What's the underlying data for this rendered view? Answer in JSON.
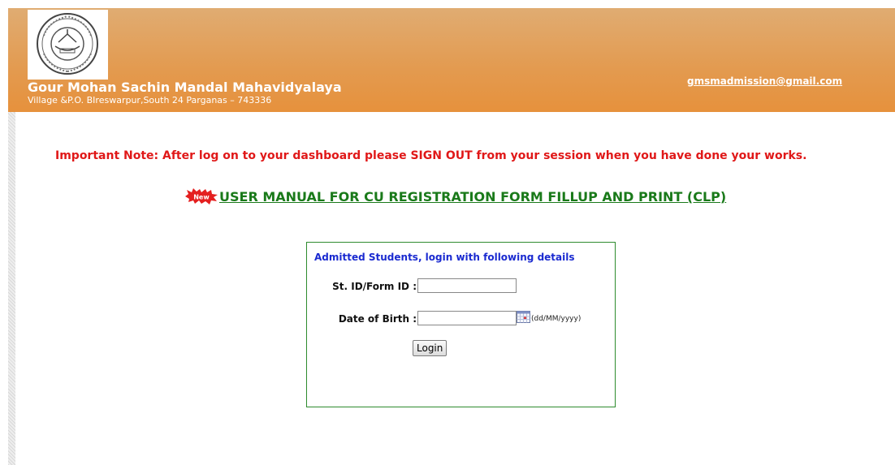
{
  "header": {
    "college_name": "Gour Mohan Sachin Mandal Mahavidyalaya",
    "address": "Village &P.O. BIreswarpur,South 24 Parganas – 743336",
    "email": "gmsmadmission@gmail.com",
    "background_color": "#e6913c"
  },
  "notice": {
    "text": "Important Note: After log on to your dashboard please SIGN OUT from your session when you have done your works.",
    "color": "#e01818"
  },
  "manual": {
    "badge": "New",
    "link_text": "USER MANUAL FOR CU REGISTRATION FORM FILLUP AND PRINT (CLP)",
    "color": "#1a7a1a"
  },
  "login": {
    "title": "Admitted Students, login with following details",
    "id_label": "St. ID/Form ID :",
    "id_value": "",
    "dob_label": "Date of Birth :",
    "dob_value": "",
    "dob_format": "(dd/MM/yyyy)",
    "button_label": "Login",
    "title_color": "#1a2ad0",
    "border_color": "#2e8b2e"
  },
  "icons": {
    "logo": "college-emblem-icon",
    "badge": "new-burst-icon",
    "calendar": "calendar-icon"
  }
}
